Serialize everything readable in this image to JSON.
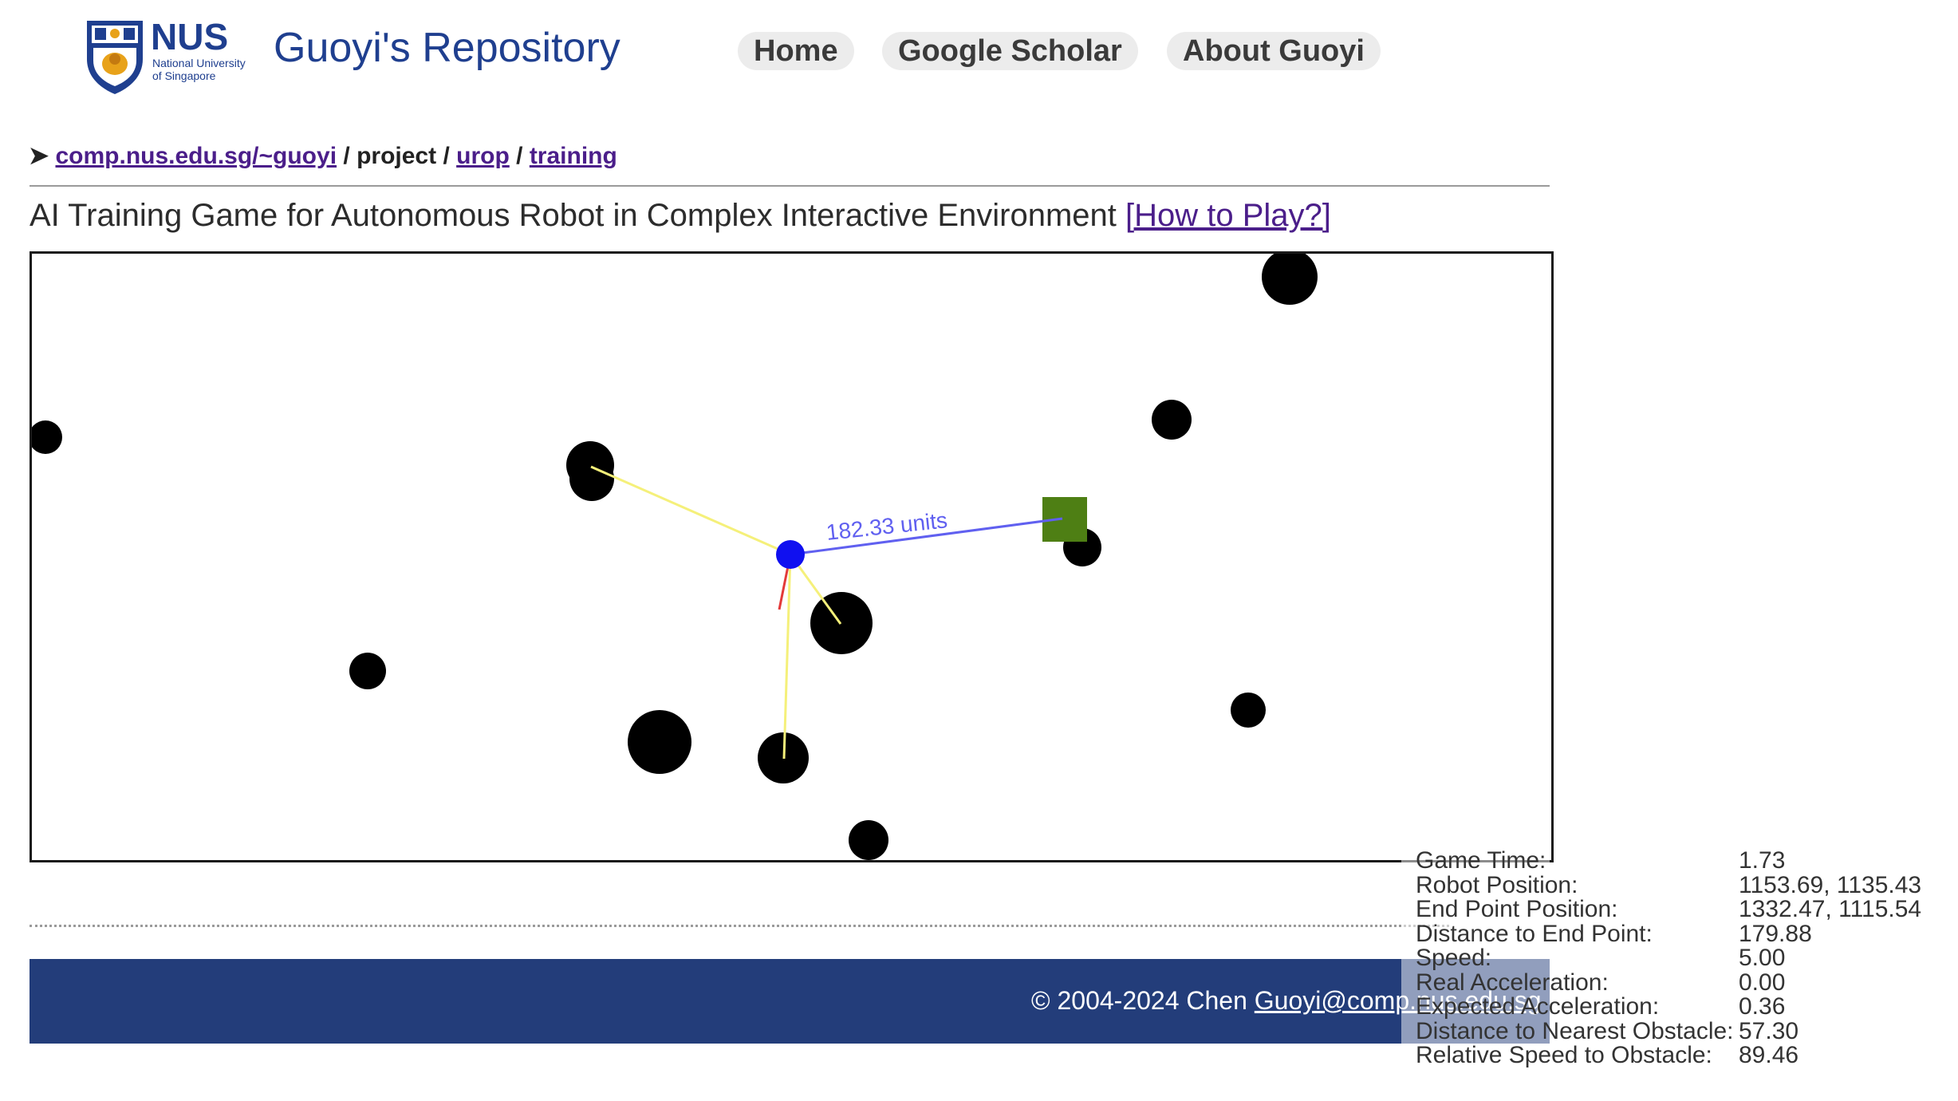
{
  "header": {
    "logo_text": "NUS",
    "logo_sub1": "National University",
    "logo_sub2": "of Singapore",
    "site_title": "Guoyi's Repository",
    "nav": [
      "Home",
      "Google Scholar",
      "About Guoyi"
    ]
  },
  "breadcrumb": {
    "arrow": "➤",
    "root": "comp.nus.edu.sg/~guoyi",
    "sep1": "/",
    "project": "project",
    "sep2": "/",
    "urop": "urop",
    "sep3": "/",
    "training": "training"
  },
  "page": {
    "title": "AI Training Game for Autonomous Robot in Complex Interactive Environment",
    "help_link": "[How to Play?]"
  },
  "game": {
    "distance_label": "182.33 units",
    "colors": {
      "robot": "#1010f0",
      "goal": "#4e7f14",
      "obstacle": "#000000",
      "sensor": "#f5f07a",
      "path": "#6060f0",
      "heading": "#e33a3a"
    }
  },
  "stats": [
    {
      "label": "Game Time:",
      "value": "1.73"
    },
    {
      "label": "Robot Position:",
      "value": "1153.69, 1135.43"
    },
    {
      "label": "End Point Position:",
      "value": "1332.47, 1115.54"
    },
    {
      "label": "Distance to End Point:",
      "value": "179.88"
    },
    {
      "label": "Speed:",
      "value": "5.00"
    },
    {
      "label": "Real Acceleration:",
      "value": "0.00"
    },
    {
      "label": "Expected Acceleration:",
      "value": "0.36"
    },
    {
      "label": "Distance to Nearest Obstacle:",
      "value": "57.30"
    },
    {
      "label": "Relative Speed to Obstacle:",
      "value": "89.46"
    }
  ],
  "footer": {
    "copyright": "© 2004-2024 Chen",
    "email": "Guoyi@comp.nus.edu.sg"
  }
}
